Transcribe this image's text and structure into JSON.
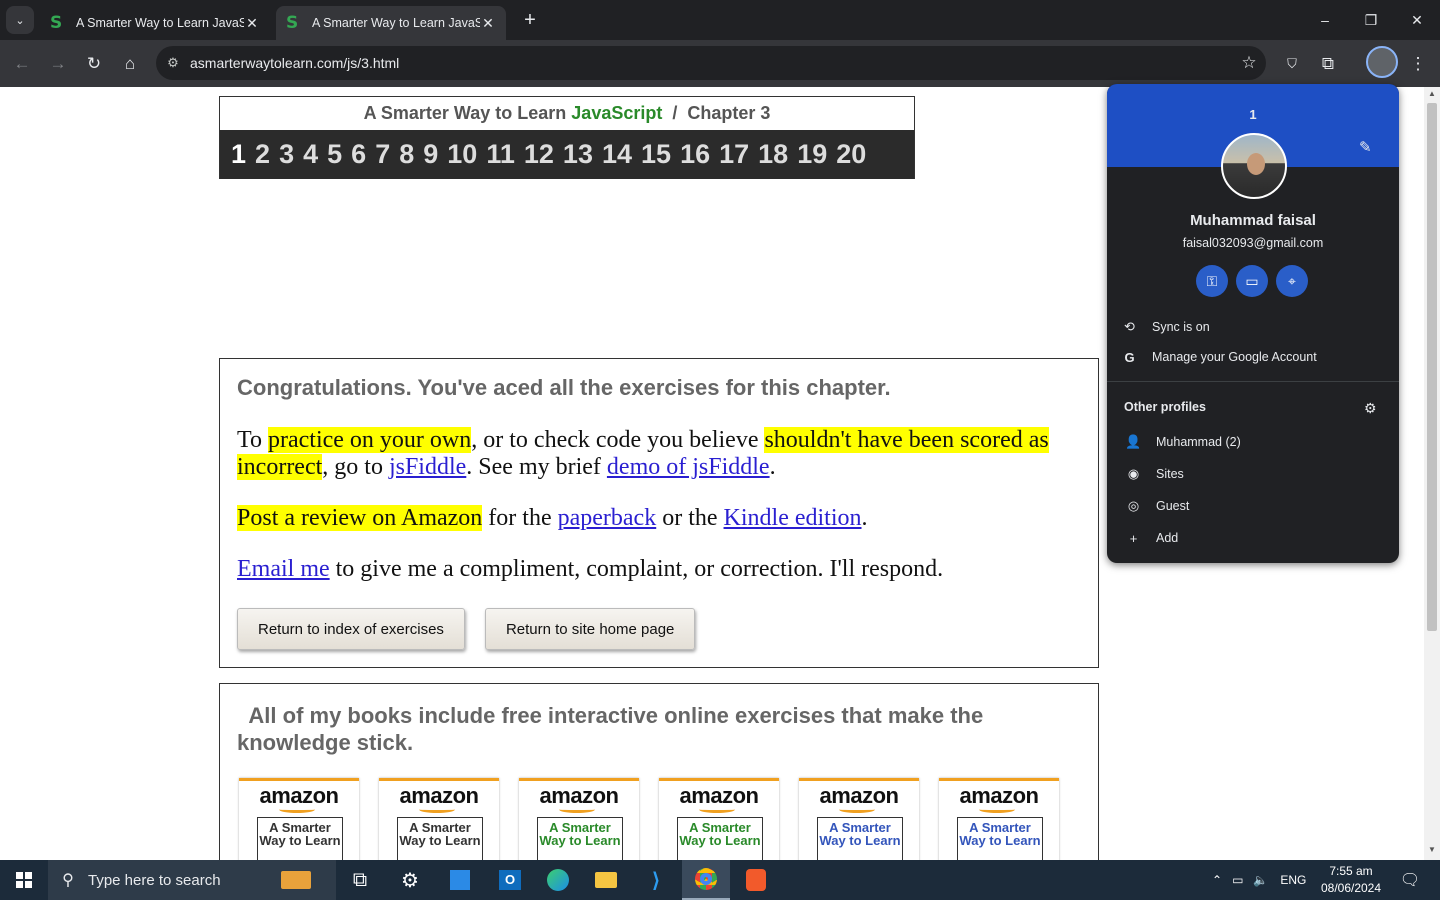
{
  "tabs": [
    {
      "title": "A Smarter Way to Learn JavaScript",
      "favicon": "S"
    },
    {
      "title": "A Smarter Way to Learn JavaScript",
      "favicon": "S"
    }
  ],
  "window": {
    "minimize": "–",
    "maximize": "❐",
    "close": "✕"
  },
  "toolbar": {
    "url": "asmarterwaytolearn.com/js/3.html"
  },
  "page": {
    "header": {
      "prefix": "A Smarter Way to Learn ",
      "language": "JavaScript",
      "sep": "/",
      "chapter": "Chapter 3"
    },
    "chapters": [
      "1",
      "2",
      "3",
      "4",
      "5",
      "6",
      "7",
      "8",
      "9",
      "10",
      "11",
      "12",
      "13",
      "14",
      "15",
      "16",
      "17",
      "18",
      "19",
      "20"
    ],
    "congrats": {
      "heading": "Congratulations. You've aced all the exercises for this chapter.",
      "p1_a": "To ",
      "p1_hl1": "practice on your own",
      "p1_b": ", or to check code you believe ",
      "p1_hl2": "shouldn't have been scored as incorrect",
      "p1_c": ", go to ",
      "p1_link1": "jsFiddle",
      "p1_d": ". See my brief ",
      "p1_link2": "demo of jsFiddle",
      "p1_e": ".",
      "p2_hl": "Post a review on Amazon",
      "p2_a": " for the ",
      "p2_link1": "paperback",
      "p2_b": " or the ",
      "p2_link2": "Kindle edition",
      "p2_c": ".",
      "p3_link": "Email me",
      "p3_a": " to give me a compliment, complaint, or correction. I'll respond.",
      "btn_index": "Return to index of exercises",
      "btn_home": "Return to site home page"
    },
    "books": {
      "heading": "All of my books include free interactive online exercises that make the knowledge stick.",
      "items": [
        {
          "brand": "amazon",
          "cover": "A Smarter Way to Learn",
          "color": "#333333"
        },
        {
          "brand": "amazon",
          "cover": "A Smarter Way to Learn",
          "color": "#333333"
        },
        {
          "brand": "amazon",
          "cover": "A Smarter Way to Learn",
          "color": "#2a8a2a"
        },
        {
          "brand": "amazon",
          "cover": "A Smarter Way to Learn",
          "color": "#2a8a2a"
        },
        {
          "brand": "amazon",
          "cover": "A Smarter Way to Learn",
          "color": "#3355bb"
        },
        {
          "brand": "amazon",
          "cover": "A Smarter Way to Learn",
          "color": "#3355bb"
        }
      ]
    }
  },
  "profile": {
    "label": "1",
    "name": "Muhammad faisal",
    "email": "faisal032093@gmail.com",
    "sync": "Sync is on",
    "manage": "Manage your Google Account",
    "other_profiles": "Other profiles",
    "profiles": [
      "Muhammad (2)",
      "Sites",
      "Guest",
      "Add"
    ]
  },
  "taskbar": {
    "search_placeholder": "Type here to search",
    "lang": "ENG",
    "time": "7:55 am",
    "date": "08/06/2024"
  },
  "colors": {
    "accent": "#1e4fc4",
    "highlight": "#ffff00",
    "link": "#2a1fd1"
  }
}
